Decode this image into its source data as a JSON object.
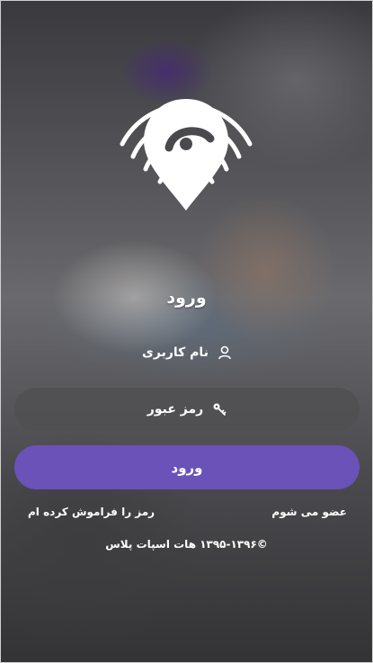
{
  "header": {
    "title": "ورود"
  },
  "form": {
    "username_label": "نام کاربری",
    "password_label": "رمز عبور",
    "login_button": "ورود"
  },
  "links": {
    "register": "عضو می شوم",
    "forgot_password": "رمز را فراموش کرده ام"
  },
  "footer": {
    "copyright": "©۱۳۹۵-۱۳۹۶ هات اسپات پلاس"
  },
  "colors": {
    "accent": "#6a52b8",
    "field_bg": "#505052",
    "text": "#ffffff"
  },
  "icons": {
    "logo": "location-pin-wifi-icon",
    "username": "user-icon",
    "password": "key-icon"
  }
}
